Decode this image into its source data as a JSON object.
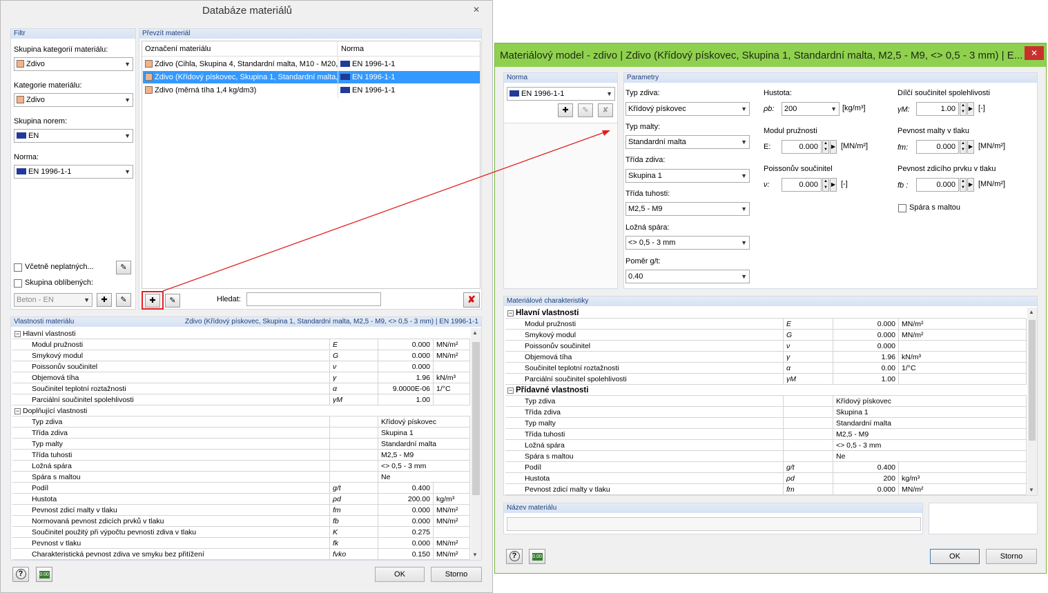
{
  "left": {
    "title": "Databáze materiálů",
    "close": "✕",
    "filter": {
      "header": "Filtr",
      "group_category_label": "Skupina kategorií materiálu:",
      "group_category_value": "Zdivo",
      "category_label": "Kategorie materiálu:",
      "category_value": "Zdivo",
      "norm_group_label": "Skupina norem:",
      "norm_group_value": "EN",
      "norm_label": "Norma:",
      "norm_value": "EN 1996-1-1",
      "incl_invalid": "Včetně neplatných...",
      "favorites": "Skupina oblíbených:",
      "favorites_value": "Beton - EN"
    },
    "take": {
      "header": "Převzít materiál",
      "col_name": "Označení materiálu",
      "col_norm": "Norma",
      "rows": [
        {
          "name": "Zdivo (Cihla, Skupina 4, Standardní malta, M10 - M20,",
          "norm": "EN 1996-1-1"
        },
        {
          "name": "Zdivo (Křídový pískovec, Skupina 1, Standardní malta,",
          "norm": "EN 1996-1-1"
        },
        {
          "name": "Zdivo (měrná tíha 1,4 kg/dm3)",
          "norm": "EN 1996-1-1"
        }
      ],
      "search_label": "Hledat:"
    },
    "props": {
      "header": "Vlastnosti materiálu",
      "header_right": "Zdivo (Křídový pískovec, Skupina 1, Standardní malta, M2,5 - M9, <> 0,5 - 3 mm)  |  EN 1996-1-1",
      "main_group": "Hlavní vlastnosti",
      "main": [
        {
          "name": "Modul pružnosti",
          "sym": "E",
          "val": "0.000",
          "unit": "MN/m²"
        },
        {
          "name": "Smykový modul",
          "sym": "G",
          "val": "0.000",
          "unit": "MN/m²"
        },
        {
          "name": "Poissonův součinitel",
          "sym": "ν",
          "val": "0.000",
          "unit": ""
        },
        {
          "name": "Objemová tíha",
          "sym": "γ",
          "val": "1.96",
          "unit": "kN/m³"
        },
        {
          "name": "Součinitel teplotní roztažnosti",
          "sym": "α",
          "val": "9.0000E-06",
          "unit": "1/°C"
        },
        {
          "name": "Parciální součinitel spolehlivosti",
          "sym": "γM",
          "val": "1.00",
          "unit": ""
        }
      ],
      "add_group": "Doplňující vlastnosti",
      "add": [
        {
          "name": "Typ zdiva",
          "sym": "",
          "val": "Křídový pískovec",
          "unit": "",
          "left": true
        },
        {
          "name": "Třída zdiva",
          "sym": "",
          "val": "Skupina 1",
          "unit": "",
          "left": true
        },
        {
          "name": "Typ malty",
          "sym": "",
          "val": "Standardní malta",
          "unit": "",
          "left": true
        },
        {
          "name": "Třída tuhosti",
          "sym": "",
          "val": "M2,5 - M9",
          "unit": "",
          "left": true
        },
        {
          "name": "Ložná spára",
          "sym": "",
          "val": "<> 0,5 - 3 mm",
          "unit": "",
          "left": true
        },
        {
          "name": "Spára s maltou",
          "sym": "",
          "val": "Ne",
          "unit": "",
          "left": true
        },
        {
          "name": "Podíl",
          "sym": "g/t",
          "val": "0.400",
          "unit": ""
        },
        {
          "name": "Hustota",
          "sym": "ρd",
          "val": "200.00",
          "unit": "kg/m³"
        },
        {
          "name": "Pevnost zdicí malty v tlaku",
          "sym": "fm",
          "val": "0.000",
          "unit": "MN/m²"
        },
        {
          "name": "Normovaná pevnost zdicích prvků v tlaku",
          "sym": "fb",
          "val": "0.000",
          "unit": "MN/m²"
        },
        {
          "name": "Součinitel použitý při výpočtu pevnosti zdiva v tlaku",
          "sym": "K",
          "val": "0.275",
          "unit": ""
        },
        {
          "name": "Pevnost v tlaku",
          "sym": "fk",
          "val": "0.000",
          "unit": "MN/m²"
        },
        {
          "name": "Charakteristická pevnost zdiva ve smyku bez přitížení",
          "sym": "fvko",
          "val": "0.150",
          "unit": "MN/m²"
        }
      ]
    },
    "ok": "OK",
    "cancel": "Storno"
  },
  "right": {
    "title": "Materiálový model - zdivo | Zdivo (Křídový pískovec, Skupina 1, Standardní malta, M2,5 - M9, <> 0,5 - 3 mm) | E...",
    "close": "✕",
    "norm_header": "Norma",
    "norm_value": "EN 1996-1-1",
    "params_header": "Parametry",
    "type_label": "Typ zdiva:",
    "type_value": "Křídový pískovec",
    "mortar_label": "Typ malty:",
    "mortar_value": "Standardní malta",
    "class_label": "Třída zdiva:",
    "class_value": "Skupina 1",
    "stiff_label": "Třída tuhosti:",
    "stiff_value": "M2,5 - M9",
    "joint_label": "Ložná spára:",
    "joint_value": "<> 0,5 - 3 mm",
    "ratio_label": "Poměr g/t:",
    "ratio_value": "0.40",
    "density_label": "Hustota:",
    "density_sym": "ρb:",
    "density_value": "200",
    "density_unit": "[kg/m³]",
    "emod_label": "Modul pružnosti",
    "emod_sym": "E:",
    "emod_value": "0.000",
    "emod_unit": "[MN/m²]",
    "poisson_label": "Poissonův součinitel",
    "poisson_sym": "ν:",
    "poisson_value": "0.000",
    "poisson_unit": "[-]",
    "gamma_label": "Dílčí součinitel spolehlivosti",
    "gamma_sym": "γM:",
    "gamma_value": "1.00",
    "gamma_unit": "[-]",
    "fm_label": "Pevnost malty v tlaku",
    "fm_sym": "fm:",
    "fm_value": "0.000",
    "fm_unit": "[MN/m²]",
    "fb_label": "Pevnost zdicího prvku v tlaku",
    "fb_sym": "fb :",
    "fb_value": "0.000",
    "fb_unit": "[MN/m²]",
    "joint_mortar": "Spára s maltou",
    "char_header": "Materiálové charakteristiky",
    "main_group": "Hlavní vlastnosti",
    "main": [
      {
        "name": "Modul pružnosti",
        "sym": "E",
        "val": "0.000",
        "unit": "MN/m²"
      },
      {
        "name": "Smykový modul",
        "sym": "G",
        "val": "0.000",
        "unit": "MN/m²"
      },
      {
        "name": "Poissonův součinitel",
        "sym": "ν",
        "val": "0.000",
        "unit": ""
      },
      {
        "name": "Objemová tíha",
        "sym": "γ",
        "val": "1.96",
        "unit": "kN/m³"
      },
      {
        "name": "Součinitel teplotní roztažnosti",
        "sym": "α",
        "val": "0.00",
        "unit": "1/°C"
      },
      {
        "name": "Parciální součinitel spolehlivosti",
        "sym": "γM",
        "val": "1.00",
        "unit": ""
      }
    ],
    "add_group": "Přídavné vlastnosti",
    "add": [
      {
        "name": "Typ zdiva",
        "sym": "",
        "val": "Křídový pískovec",
        "unit": "",
        "left": true
      },
      {
        "name": "Třída zdiva",
        "sym": "",
        "val": "Skupina 1",
        "unit": "",
        "left": true
      },
      {
        "name": "Typ malty",
        "sym": "",
        "val": "Standardní malta",
        "unit": "",
        "left": true
      },
      {
        "name": "Třída tuhosti",
        "sym": "",
        "val": "M2,5 - M9",
        "unit": "",
        "left": true
      },
      {
        "name": "Ložná spára",
        "sym": "",
        "val": "<> 0,5 - 3 mm",
        "unit": "",
        "left": true
      },
      {
        "name": "Spára s maltou",
        "sym": "",
        "val": "Ne",
        "unit": "",
        "left": true
      },
      {
        "name": "Podíl",
        "sym": "g/t",
        "val": "0.400",
        "unit": ""
      },
      {
        "name": "Hustota",
        "sym": "ρd",
        "val": "200",
        "unit": "kg/m³"
      },
      {
        "name": "Pevnost zdicí malty v tlaku",
        "sym": "fm",
        "val": "0.000",
        "unit": "MN/m²"
      }
    ],
    "name_header": "Název materiálu",
    "ok": "OK",
    "cancel": "Storno"
  },
  "colors": {
    "titlebar_green": "#8fd14f",
    "selection": "#3399ff",
    "arrow": "#e0201f",
    "panel_header": "#1e3f79"
  }
}
